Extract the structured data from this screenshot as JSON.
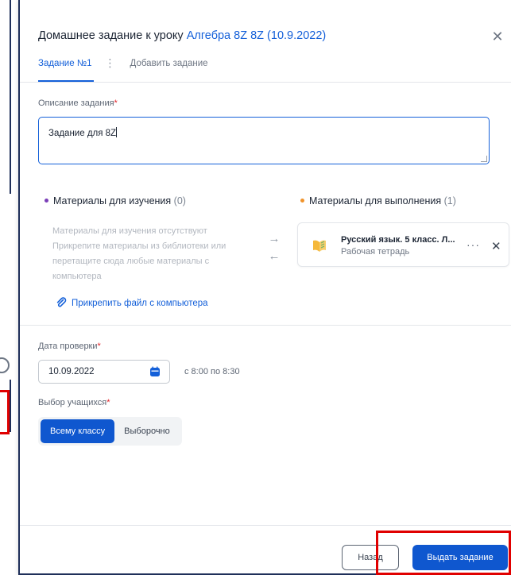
{
  "modal": {
    "title_prefix": "Домашнее задание к уроку ",
    "title_lesson": "Алгебра 8Z 8Z (10.9.2022)",
    "close_glyph": "✕"
  },
  "tabs": [
    {
      "label": "Задание №1",
      "active": true
    },
    {
      "label": "Добавить задание",
      "active": false
    }
  ],
  "tab_menu_glyph": "⋮",
  "description": {
    "label": "Описание задания",
    "required_mark": "*",
    "value": "Задание для 8Z"
  },
  "study_materials": {
    "title": "Материалы для изучения",
    "count": "(0)",
    "dot_color": "#7b3fb8",
    "empty_lines": [
      "Материалы для изучения отсутствуют",
      "Прикрепите материалы из библиотеки или",
      "перетащите сюда любые материалы с",
      "компьютера"
    ]
  },
  "arrows": {
    "right": "→",
    "left": "←"
  },
  "exec_materials": {
    "title": "Материалы для выполнения",
    "count": "(1)",
    "dot_color": "#f0932b",
    "items": [
      {
        "title": "Русский язык. 5 класс. Л...",
        "subtitle": "Рабочая тетрадь",
        "icon": "book-icon",
        "more": "···",
        "remove": "✕"
      }
    ]
  },
  "attach": {
    "label": "Прикрепить файл с компьютера",
    "icon": "paperclip-icon"
  },
  "check_date": {
    "label": "Дата проверки",
    "required_mark": "*",
    "value": "10.09.2022",
    "time": "с 8:00 по 8:30",
    "icon": "calendar-icon"
  },
  "students": {
    "label": "Выбор учащихся",
    "required_mark": "*",
    "options": [
      {
        "label": "Всему классу",
        "selected": true
      },
      {
        "label": "Выборочно",
        "selected": false
      }
    ]
  },
  "footer": {
    "back_label": "Назад",
    "issue_label": "Выдать задание"
  },
  "colors": {
    "accent": "#1460d9",
    "primary_button": "#0f57cf",
    "highlight": "#e00000"
  }
}
